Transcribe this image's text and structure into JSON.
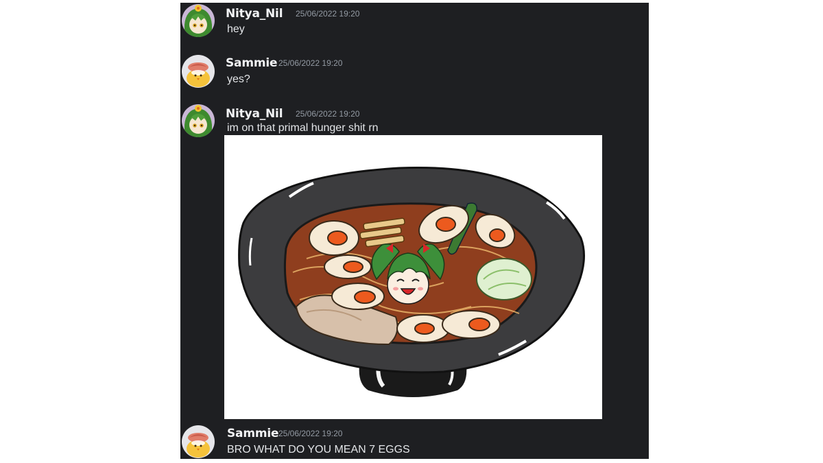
{
  "messages": [
    {
      "author": "Nitya_Nil",
      "timestamp": "25/06/2022 19:20",
      "text": "hey",
      "avatar": "green-haired-girl-icon"
    },
    {
      "author": "Sammie",
      "timestamp": "25/06/2022 19:20",
      "text": "yes?",
      "avatar": "chick-icon"
    },
    {
      "author": "Nitya_Nil",
      "timestamp": "25/06/2022 19:20",
      "text": "im on that primal hunger shit rn",
      "avatar": "green-haired-girl-icon",
      "attachment": "ramen-bowl-drawing"
    },
    {
      "author": "Sammie",
      "timestamp": "25/06/2022 19:20",
      "text": "BRO WHAT DO YOU MEAN 7 EGGS",
      "avatar": "chick-icon"
    }
  ],
  "colors": {
    "background": "#1e1f22",
    "username": "#f2f3f5",
    "timestamp": "#949ba4",
    "message_text": "#e3e5e8"
  }
}
